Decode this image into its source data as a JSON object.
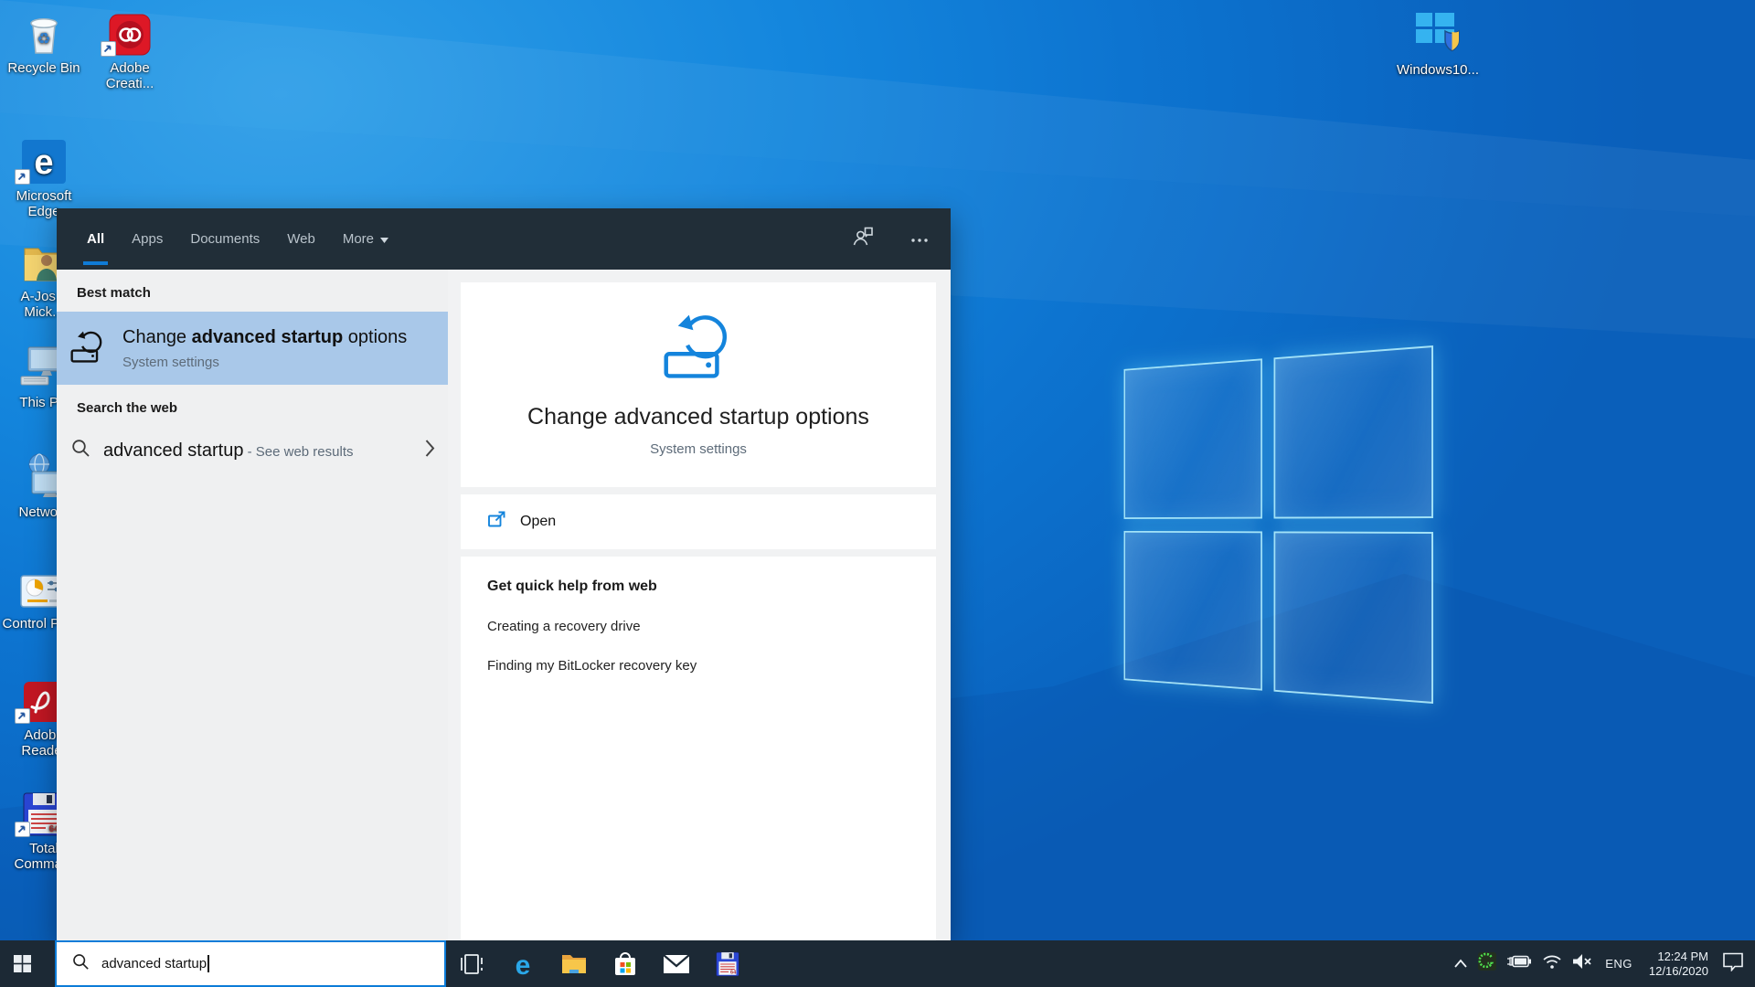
{
  "desktop": {
    "icons": [
      {
        "label_lines": [
          "Recycle Bin"
        ]
      },
      {
        "label_lines": [
          "Adobe",
          "Creati..."
        ]
      },
      {
        "label_lines": [
          "Microsoft",
          "Edge"
        ]
      },
      {
        "label_lines": [
          "A-Jos...",
          "Mick..."
        ]
      },
      {
        "label_lines": [
          "This PC"
        ]
      },
      {
        "label_lines": [
          "Network"
        ]
      },
      {
        "label_lines": [
          "Control Panel"
        ]
      },
      {
        "label_lines": [
          "Adobe",
          "Reader"
        ]
      },
      {
        "label_lines": [
          "Total",
          "Comma..."
        ]
      },
      {
        "label_lines": [
          "Windows10..."
        ]
      }
    ],
    "recycle_glyph": "♻",
    "edge_glyph": "e",
    "floppy_text": "64"
  },
  "search_flyout": {
    "tabs": {
      "all": "All",
      "apps": "Apps",
      "documents": "Documents",
      "web": "Web",
      "more": "More"
    },
    "sections": {
      "best_match": "Best match",
      "search_web": "Search the web"
    },
    "best_match_item": {
      "title_pre": "Change ",
      "title_bold": "advanced startup",
      "title_post": " options",
      "subtitle": "System settings"
    },
    "web_item": {
      "query": "advanced startup",
      "suffix": " - See web results"
    },
    "preview": {
      "title": "Change advanced startup options",
      "subtitle": "System settings",
      "open_label": "Open",
      "help_heading": "Get quick help from web",
      "links": [
        "Creating a recovery drive",
        "Finding my BitLocker recovery key"
      ]
    }
  },
  "taskbar": {
    "search_value": "advanced startup",
    "language": "ENG",
    "time": "12:24 PM",
    "date": "12/16/2020"
  },
  "colors": {
    "accent": "#0f7bd7",
    "highlight_row": "#a9c8e9",
    "header_bg": "#212e38",
    "taskbar_bg": "#1c2935",
    "preview_icon_blue": "#1484dc"
  }
}
